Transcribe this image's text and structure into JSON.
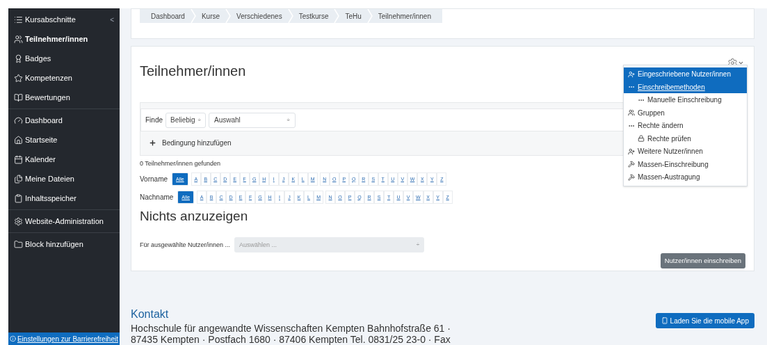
{
  "sidebar": {
    "sections": [
      {
        "items": [
          {
            "label": "Kursabschnitte",
            "selected": false,
            "collapse": "<"
          },
          {
            "label": "Teilnehmer/innen",
            "selected": true
          },
          {
            "label": "Badges",
            "selected": false
          },
          {
            "label": "Kompetenzen",
            "selected": false
          },
          {
            "label": "Bewertungen",
            "selected": false
          }
        ]
      },
      {
        "items": [
          {
            "label": "Dashboard",
            "selected": false
          },
          {
            "label": "Startseite",
            "selected": false
          },
          {
            "label": "Kalender",
            "selected": false
          },
          {
            "label": "Meine Dateien",
            "selected": false
          },
          {
            "label": "Inhaltsspeicher",
            "selected": false
          }
        ]
      },
      {
        "items": [
          {
            "label": "Website-Administration",
            "selected": false
          }
        ]
      },
      {
        "items": [
          {
            "label": "Block hinzufügen",
            "selected": false
          }
        ]
      }
    ],
    "accessibility_link": "Einstellungen zur Barrierefreiheit"
  },
  "breadcrumb": [
    "Dashboard",
    "Kurse",
    "Verschiedenes",
    "Testkurse",
    "TeHu",
    "Teilnehmer/innen"
  ],
  "page_title": "Teilnehmer/innen",
  "settings_menu": {
    "items": [
      {
        "label": "Eingeschriebene Nutzer/innen",
        "highlighted": true,
        "underlined": false
      },
      {
        "label": "Einschreibemethoden",
        "highlighted": true,
        "underlined": true,
        "children": [
          {
            "label": "Manuelle Einschreibung",
            "highlighted": false,
            "underlined": false
          }
        ]
      },
      {
        "label": "Gruppen",
        "highlighted": false,
        "underlined": false
      },
      {
        "label": "Rechte ändern",
        "highlighted": false,
        "underlined": false,
        "children": [
          {
            "label": "Rechte prüfen",
            "highlighted": false,
            "underlined": false
          }
        ]
      },
      {
        "label": "Weitere Nutzer/innen",
        "highlighted": false,
        "underlined": false
      },
      {
        "label": "Massen-Einschreibung",
        "highlighted": false,
        "underlined": false
      },
      {
        "label": "Massen-Austragung",
        "highlighted": false,
        "underlined": false
      }
    ]
  },
  "filter": {
    "label": "Finde",
    "match": "Beliebig",
    "match_arrow": "÷",
    "type": "Auswahl",
    "type_arrow": "÷",
    "add_condition": "Bedingung hinzufügen"
  },
  "result_count": "0 Teilnehmer/innen gefunden",
  "initials_bars": [
    {
      "label": "Vorname",
      "letters": [
        {
          "label": "Alle",
          "selected": true
        },
        {
          "label": "A",
          "selected": false
        },
        {
          "label": "B",
          "selected": false
        },
        {
          "label": "C",
          "selected": false
        },
        {
          "label": "D",
          "selected": false
        },
        {
          "label": "E",
          "selected": false
        },
        {
          "label": "F",
          "selected": false
        },
        {
          "label": "G",
          "selected": false
        },
        {
          "label": "H",
          "selected": false
        },
        {
          "label": "I",
          "selected": false
        },
        {
          "label": "J",
          "selected": false
        },
        {
          "label": "K",
          "selected": false
        },
        {
          "label": "L",
          "selected": false
        },
        {
          "label": "M",
          "selected": false
        },
        {
          "label": "N",
          "selected": false
        },
        {
          "label": "O",
          "selected": false
        },
        {
          "label": "P",
          "selected": false
        },
        {
          "label": "Q",
          "selected": false
        },
        {
          "label": "R",
          "selected": false
        },
        {
          "label": "S",
          "selected": false
        },
        {
          "label": "T",
          "selected": false
        },
        {
          "label": "U",
          "selected": false
        },
        {
          "label": "V",
          "selected": false
        },
        {
          "label": "W",
          "selected": false
        },
        {
          "label": "X",
          "selected": false
        },
        {
          "label": "Y",
          "selected": false
        },
        {
          "label": "Z",
          "selected": false
        }
      ]
    },
    {
      "label": "Nachname",
      "letters": [
        {
          "label": "Alle",
          "selected": true
        },
        {
          "label": "A",
          "selected": false
        },
        {
          "label": "B",
          "selected": false
        },
        {
          "label": "C",
          "selected": false
        },
        {
          "label": "D",
          "selected": false
        },
        {
          "label": "E",
          "selected": false
        },
        {
          "label": "F",
          "selected": false
        },
        {
          "label": "G",
          "selected": false
        },
        {
          "label": "H",
          "selected": false
        },
        {
          "label": "I",
          "selected": false
        },
        {
          "label": "J",
          "selected": false
        },
        {
          "label": "K",
          "selected": false
        },
        {
          "label": "L",
          "selected": false
        },
        {
          "label": "M",
          "selected": false
        },
        {
          "label": "N",
          "selected": false
        },
        {
          "label": "O",
          "selected": false
        },
        {
          "label": "P",
          "selected": false
        },
        {
          "label": "Q",
          "selected": false
        },
        {
          "label": "R",
          "selected": false
        },
        {
          "label": "S",
          "selected": false
        },
        {
          "label": "T",
          "selected": false
        },
        {
          "label": "U",
          "selected": false
        },
        {
          "label": "V",
          "selected": false
        },
        {
          "label": "W",
          "selected": false
        },
        {
          "label": "X",
          "selected": false
        },
        {
          "label": "Y",
          "selected": false
        },
        {
          "label": "Z",
          "selected": false
        }
      ]
    }
  ],
  "empty_message": "Nichts anzuzeigen",
  "bulk_action": {
    "label": "Für ausgewählte Nutzer/innen ...",
    "placeholder": "Auswählen ...",
    "arrow": "÷",
    "disabled": true
  },
  "enrol_button": "Nutzer/innen einschreiben",
  "footer": {
    "heading": "Kontakt",
    "lines": [
      "Hochschule für angewandte Wissenschaften Kempten Bahnhofstraße 61 ·",
      "87435 Kempten · Postfach 1680 · 87406 Kempten Tel. 0831/25 23-0 · Fax"
    ],
    "app_button": "Laden Sie die mobile App"
  }
}
